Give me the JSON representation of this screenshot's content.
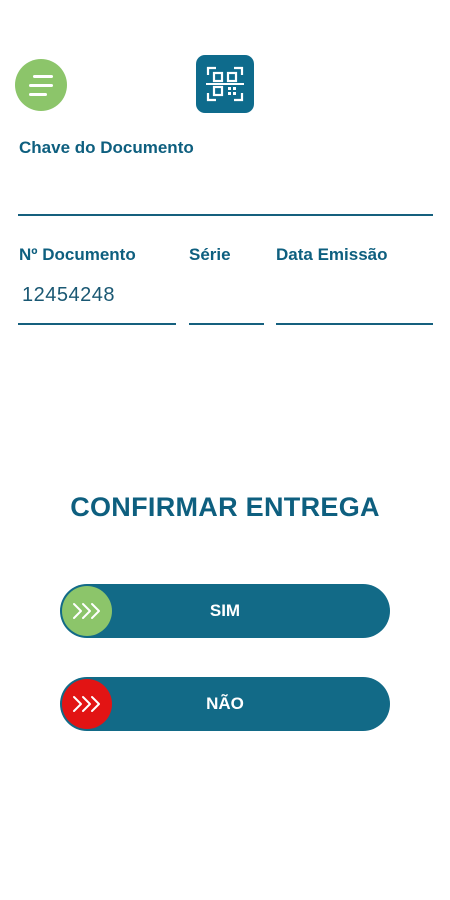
{
  "header": {
    "menu_icon": "hamburger-menu-icon",
    "logo_icon": "qr-code-scan-icon"
  },
  "form": {
    "chave_label": "Chave do Documento",
    "chave_value": "",
    "documento_label": "Nº Documento",
    "documento_value": "12454248",
    "serie_label": "Série",
    "serie_value": "",
    "data_emissao_label": "Data Emissão",
    "data_emissao_value": ""
  },
  "confirm": {
    "title": "CONFIRMAR ENTREGA",
    "sim_label": "SIM",
    "nao_label": "NÃO",
    "sim_icon": "triple-chevron-right-icon",
    "nao_icon": "triple-chevron-right-icon"
  },
  "colors": {
    "primary": "#126a87",
    "accent_green": "#8cc56a",
    "accent_red": "#e21414",
    "text": "#0e5f7f"
  }
}
